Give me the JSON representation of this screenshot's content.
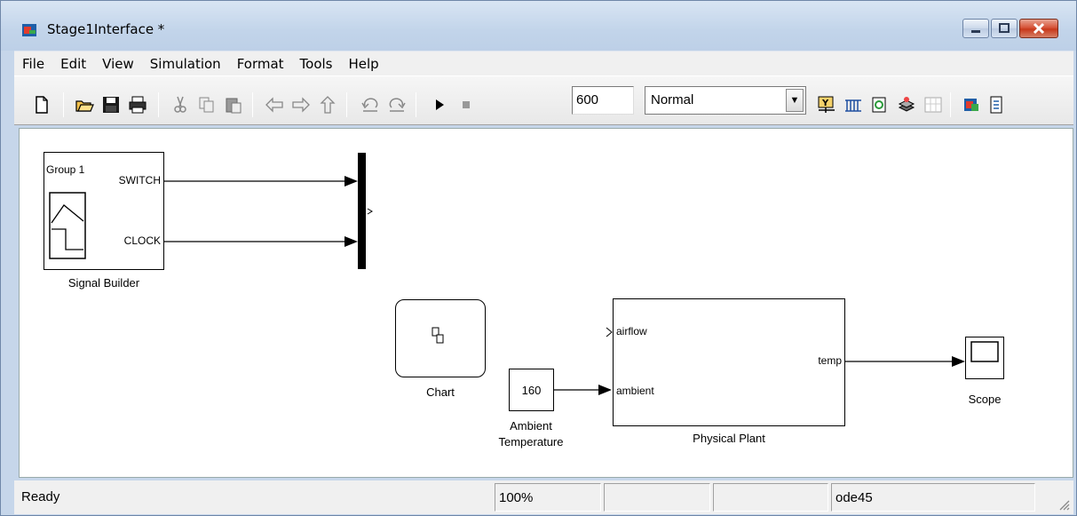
{
  "window": {
    "title": "Stage1Interface *"
  },
  "menu": [
    "File",
    "Edit",
    "View",
    "Simulation",
    "Format",
    "Tools",
    "Help"
  ],
  "toolbar": {
    "stop_time": "600",
    "sim_mode": "Normal",
    "icons": [
      "new-icon",
      "open-icon",
      "save-icon",
      "print-icon",
      "cut-icon",
      "copy-icon",
      "paste-icon",
      "back-icon",
      "forward-icon",
      "up-icon",
      "undo-icon",
      "redo-icon",
      "run-icon",
      "stop-icon",
      "build-icon",
      "update-diagram-icon",
      "refresh-icon",
      "library-icon",
      "model-explorer-icon",
      "debug-icon",
      "report-icon"
    ]
  },
  "diagram": {
    "signal_builder": {
      "group": "Group 1",
      "out1": "SWITCH",
      "out2": "CLOCK",
      "label": "Signal Builder"
    },
    "chart": {
      "label": "Chart"
    },
    "constant": {
      "value": "160",
      "label_line1": "Ambient",
      "label_line2": "Temperature"
    },
    "plant": {
      "in1": "airflow",
      "in2": "ambient",
      "out1": "temp",
      "label": "Physical Plant"
    },
    "scope": {
      "label": "Scope"
    }
  },
  "status": {
    "ready": "Ready",
    "zoom": "100%",
    "cell3": "",
    "cell4": "",
    "solver": "ode45"
  }
}
